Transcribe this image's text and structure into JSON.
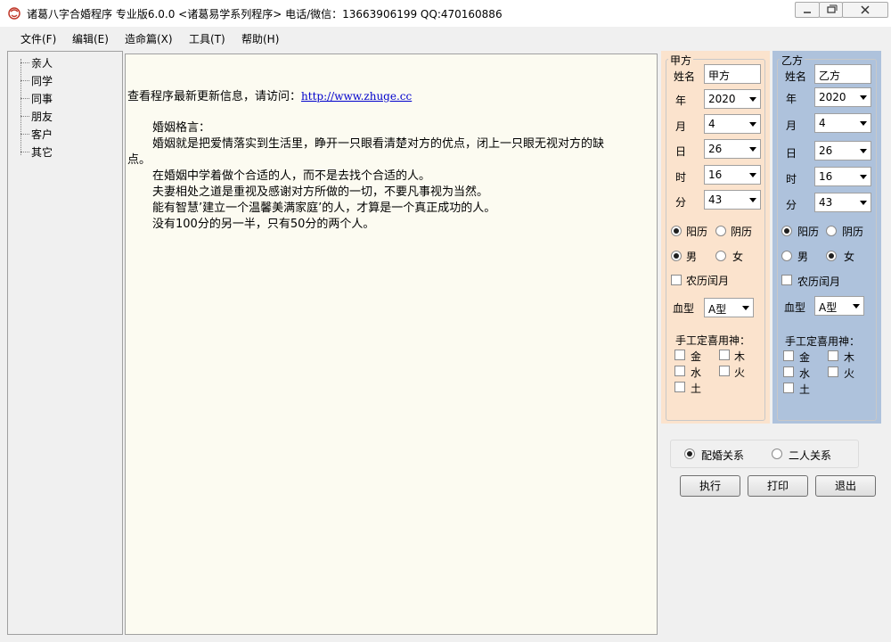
{
  "window": {
    "title": "诸葛八字合婚程序 专业版6.0.0    <诸葛易学系列程序>  电话/微信：13663906199   QQ:470160886",
    "controls": {
      "minimize": "—",
      "maximize": "□",
      "close": "✕"
    }
  },
  "menu": {
    "file": "文件(F)",
    "edit": "编辑(E)",
    "fate": "造命篇(X)",
    "tools": "工具(T)",
    "help": "帮助(H)"
  },
  "tree": {
    "items": [
      "亲人",
      "同学",
      "同事",
      "朋友",
      "客户",
      "其它"
    ]
  },
  "content": {
    "update_prefix": "查看程序最新更新信息，请访问：",
    "update_link": "http://www.zhuge.cc",
    "heading": "婚姻格言：",
    "line1": "婚姻就是把爱情落实到生活里，睁开一只眼看清楚对方的优点，闭上一只眼无视对方的缺",
    "line1_wrap": "点。",
    "line2": "在婚姻中学着做个合适的人，而不是去找个合适的人。",
    "line3": "夫妻相处之道是重视及感谢对方所做的一切，不要凡事视为当然。",
    "line4": "能有智慧’建立一个温馨美满家庭’的人，才算是一个真正成功的人。",
    "line5": "没有100分的另一半，只有50分的两个人。"
  },
  "party_a": {
    "title": "甲方",
    "name_label": "姓名",
    "name": "甲方",
    "year_label": "年",
    "year": "2020",
    "month_label": "月",
    "month": "4",
    "day_label": "日",
    "day": "26",
    "hour_label": "时",
    "hour": "16",
    "minute_label": "分",
    "minute": "43",
    "solar": "阳历",
    "lunar": "阴历",
    "male": "男",
    "female": "女",
    "leap_month": "农历闰月",
    "blood_label": "血型",
    "blood": "A型",
    "god_label": "手工定喜用神：",
    "metal": "金",
    "wood": "木",
    "water": "水",
    "fire": "火",
    "earth": "土"
  },
  "party_b": {
    "title": "乙方",
    "name_label": "姓名",
    "name": "乙方",
    "year_label": "年",
    "year": "2020",
    "month_label": "月",
    "month": "4",
    "day_label": "日",
    "day": "26",
    "hour_label": "时",
    "hour": "16",
    "minute_label": "分",
    "minute": "43",
    "solar": "阳历",
    "lunar": "阴历",
    "male": "男",
    "female": "女",
    "leap_month": "农历闰月",
    "blood_label": "血型",
    "blood": "A型",
    "god_label": "手工定喜用神：",
    "metal": "金",
    "wood": "木",
    "water": "水",
    "fire": "火",
    "earth": "土"
  },
  "relation": {
    "marriage": "配婚关系",
    "two_people": "二人关系"
  },
  "buttons": {
    "execute": "执行",
    "print": "打印",
    "exit": "退出"
  },
  "colors": {
    "panel_a_bg": "#fbe3cd",
    "panel_b_bg": "#aec2dc",
    "content_bg": "#fcfbf1",
    "link": "#0000cc"
  }
}
